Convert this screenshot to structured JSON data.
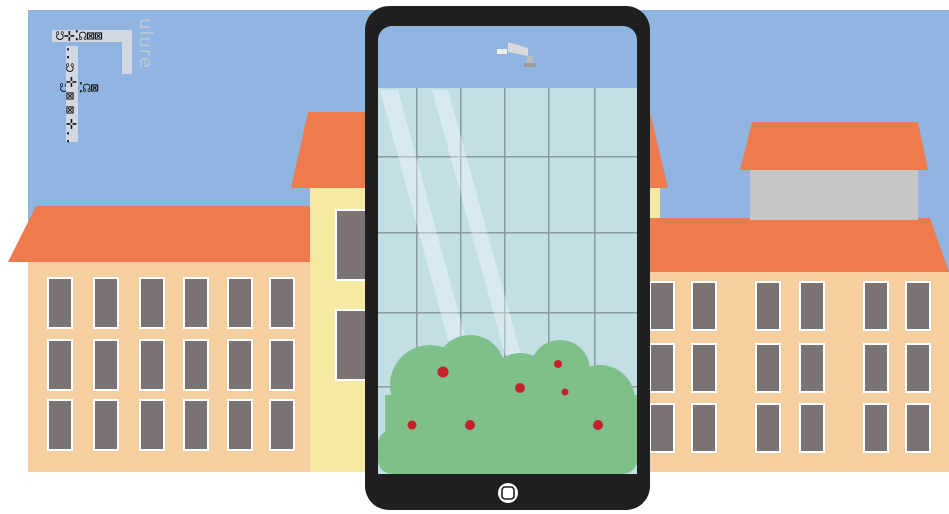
{
  "scene": {
    "description_free": true,
    "sky_color": "#8fb5e0",
    "roof_color": "#ee7b4e",
    "wall_color": "#f6cfa0",
    "tower_color": "#f5e9a3",
    "window_color": "#7b7373",
    "phone_body_color": "#1f1f1f",
    "phone_screen_sky_color": "#8fb5e0",
    "glass_color": "#c2dfe6",
    "bush_color": "#7fbf8a",
    "berry_color": "#c8202a"
  },
  "logo": {
    "glyph_line_1": "☋⊹⁚☊⊠⊠",
    "glyph_line_2": "☋⊹⁚☊⊠",
    "vertical_text": "ulure"
  },
  "phone": {
    "home_button_icon": "home-button-icon",
    "camera_icon": "security-camera-icon"
  }
}
